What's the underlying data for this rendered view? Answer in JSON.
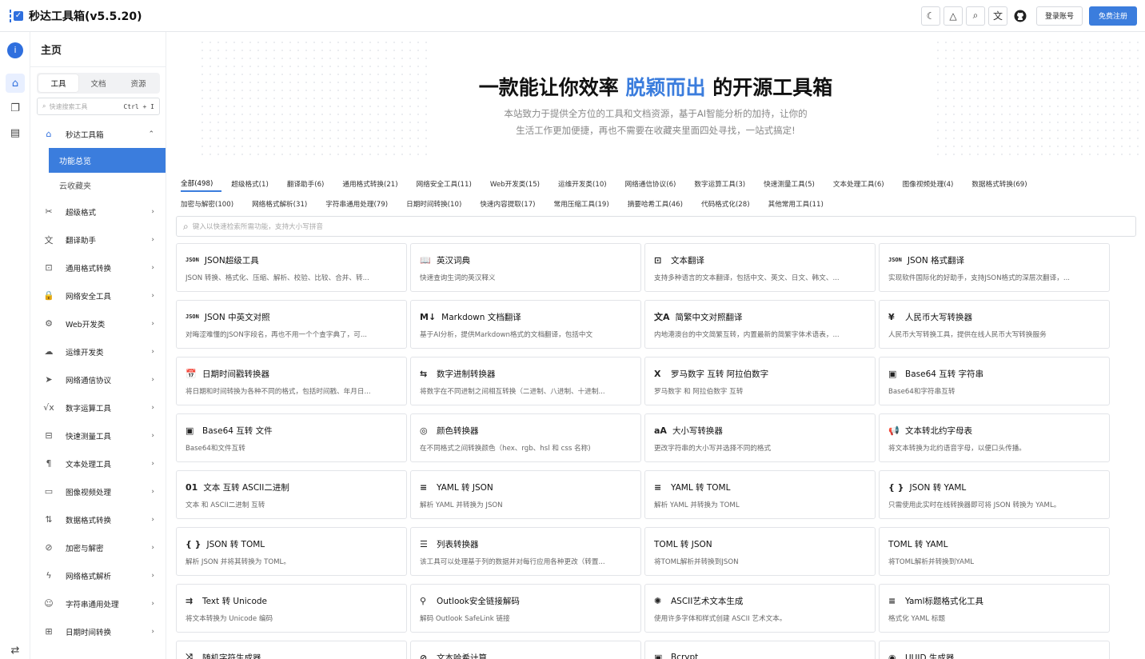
{
  "app": {
    "title": "秒达工具箱(v5.5.20)"
  },
  "topbar": {
    "icons": [
      "moon-icon",
      "alert-icon",
      "search-zoom-icon",
      "translate-icon",
      "github-icon"
    ],
    "login_label": "登录账号",
    "register_label": "免费注册"
  },
  "sidebar": {
    "header": "主页",
    "tabs": [
      "工具",
      "文档",
      "资源"
    ],
    "search_placeholder": "快速搜索工具",
    "search_shortcut": "Ctrl + I",
    "group_open": "秒达工具箱",
    "subitems": [
      "功能总览",
      "云收藏夹"
    ],
    "items": [
      "超级格式",
      "翻译助手",
      "通用格式转换",
      "网络安全工具",
      "Web开发类",
      "运维开发类",
      "网络通信协议",
      "数字运算工具",
      "快速测量工具",
      "文本处理工具",
      "图像视频处理",
      "数据格式转换",
      "加密与解密",
      "网络格式解析",
      "字符串通用处理",
      "日期时间转换"
    ]
  },
  "hero": {
    "title_pre": "一款能让你效率 ",
    "title_highlight": "脱颖而出",
    "title_post": " 的开源工具箱",
    "subtitle_line1": "本站致力于提供全方位的工具和文档资源，基于AI智能分析的加持，让你的",
    "subtitle_line2": "生活工作更加便捷，再也不需要在收藏夹里面四处寻找，一站式搞定!"
  },
  "categories_row1": [
    "全部(498)",
    "超级格式(1)",
    "翻译助手(6)",
    "通用格式转换(21)",
    "网络安全工具(11)",
    "Web开发类(15)",
    "运维开发类(10)",
    "网络通信协议(6)",
    "数字运算工具(3)",
    "快速测量工具(5)",
    "文本处理工具(6)",
    "图像视频处理(4)",
    "数据格式转换(69)"
  ],
  "categories_row2": [
    "加密与解密(100)",
    "网络格式解析(31)",
    "字符串通用处理(79)",
    "日期时间转换(10)",
    "快速内容提取(17)",
    "常用压缩工具(19)",
    "摘要哈希工具(46)",
    "代码格式化(28)",
    "其他常用工具(11)"
  ],
  "tool_search_placeholder": "键入以快速检索所需功能，支持大小写拼音",
  "tools": [
    {
      "icon": "JSON",
      "title": "JSON超级工具",
      "desc": "JSON 转换、格式化、压缩、解析、校验、比较、合并、转..."
    },
    {
      "icon": "📖",
      "title": "英汉词典",
      "desc": "快速查询生词的英汉释义"
    },
    {
      "icon": "⊡",
      "title": "文本翻译",
      "desc": "支持多种语言的文本翻译，包括中文、英文、日文、韩文、..."
    },
    {
      "icon": "JSON",
      "title": "JSON 格式翻译",
      "desc": "实现软件国际化的好助手，支持JSON格式的深层次翻译，..."
    },
    {
      "icon": "JSON",
      "title": "JSON 中英文对照",
      "desc": "对晦涩难懂的JSON字段名，再也不用一个个查字典了，可..."
    },
    {
      "icon": "M↓",
      "title": "Markdown 文档翻译",
      "desc": "基于AI分析，提供Markdown格式的文档翻译，包括中文"
    },
    {
      "icon": "文A",
      "title": "简繁中文对照翻译",
      "desc": "内地港澳台的中文简繁互转，内置最新的简繁字体术语表，..."
    },
    {
      "icon": "¥",
      "title": "人民币大写转换器",
      "desc": "人民币大写转换工具，提供在线人民币大写转换服务"
    },
    {
      "icon": "📅",
      "title": "日期时间戳转换器",
      "desc": "将日期和时间转换为各种不同的格式，包括时间戳、年月日..."
    },
    {
      "icon": "⇆",
      "title": "数字进制转换器",
      "desc": "将数字在不同进制之间相互转换（二进制、八进制、十进制..."
    },
    {
      "icon": "X",
      "title": "罗马数字 互转 阿拉伯数字",
      "desc": "罗马数字 和 阿拉伯数字 互转"
    },
    {
      "icon": "▣",
      "title": "Base64 互转 字符串",
      "desc": "Base64和字符串互转"
    },
    {
      "icon": "▣",
      "title": "Base64 互转 文件",
      "desc": "Base64和文件互转"
    },
    {
      "icon": "◎",
      "title": "颜色转换器",
      "desc": "在不同格式之间转换颜色（hex、rgb、hsl 和 css 名称)"
    },
    {
      "icon": "aA",
      "title": "大小写转换器",
      "desc": "更改字符串的大小写并选择不同的格式"
    },
    {
      "icon": "📢",
      "title": "文本转北约字母表",
      "desc": "将文本转换为北约语音字母，以便口头传播。"
    },
    {
      "icon": "01",
      "title": "文本 互转 ASCII二进制",
      "desc": "文本 和 ASCII二进制 互转"
    },
    {
      "icon": "≡",
      "title": "YAML 转 JSON",
      "desc": "解析 YAML 并转换为 JSON"
    },
    {
      "icon": "≡",
      "title": "YAML 转 TOML",
      "desc": "解析 YAML 并转换为 TOML"
    },
    {
      "icon": "{ }",
      "title": "JSON 转 YAML",
      "desc": "只需使用此实时在线转换器即可将 JSON 转换为 YAML。"
    },
    {
      "icon": "{ }",
      "title": "JSON 转 TOML",
      "desc": "解析 JSON 并将其转换为 TOML。"
    },
    {
      "icon": "☰",
      "title": "列表转换器",
      "desc": "该工具可以处理基于列的数据并对每行应用各种更改（转置..."
    },
    {
      "icon": "",
      "title": "TOML 转 JSON",
      "desc": "将TOML解析并转换到JSON"
    },
    {
      "icon": "",
      "title": "TOML 转 YAML",
      "desc": "将TOML解析并转换到YAML"
    },
    {
      "icon": "⇉",
      "title": "Text 转 Unicode",
      "desc": "将文本转换为 Unicode 编码"
    },
    {
      "icon": "⚲",
      "title": "Outlook安全链接解码",
      "desc": "解码 Outlook SafeLink 链接"
    },
    {
      "icon": "✺",
      "title": "ASCII艺术文本生成",
      "desc": "使用许多字体和样式创建 ASCII 艺术文本。"
    },
    {
      "icon": "≡",
      "title": "Yaml标题格式化工具",
      "desc": "格式化 YAML 标题"
    },
    {
      "icon": "⤨",
      "title": "随机字符生成器",
      "desc": ""
    },
    {
      "icon": "⊘",
      "title": "文本哈希计算",
      "desc": ""
    },
    {
      "icon": "▣",
      "title": "Bcrypt",
      "desc": ""
    },
    {
      "icon": "◉",
      "title": "UUID 生成器",
      "desc": ""
    }
  ]
}
